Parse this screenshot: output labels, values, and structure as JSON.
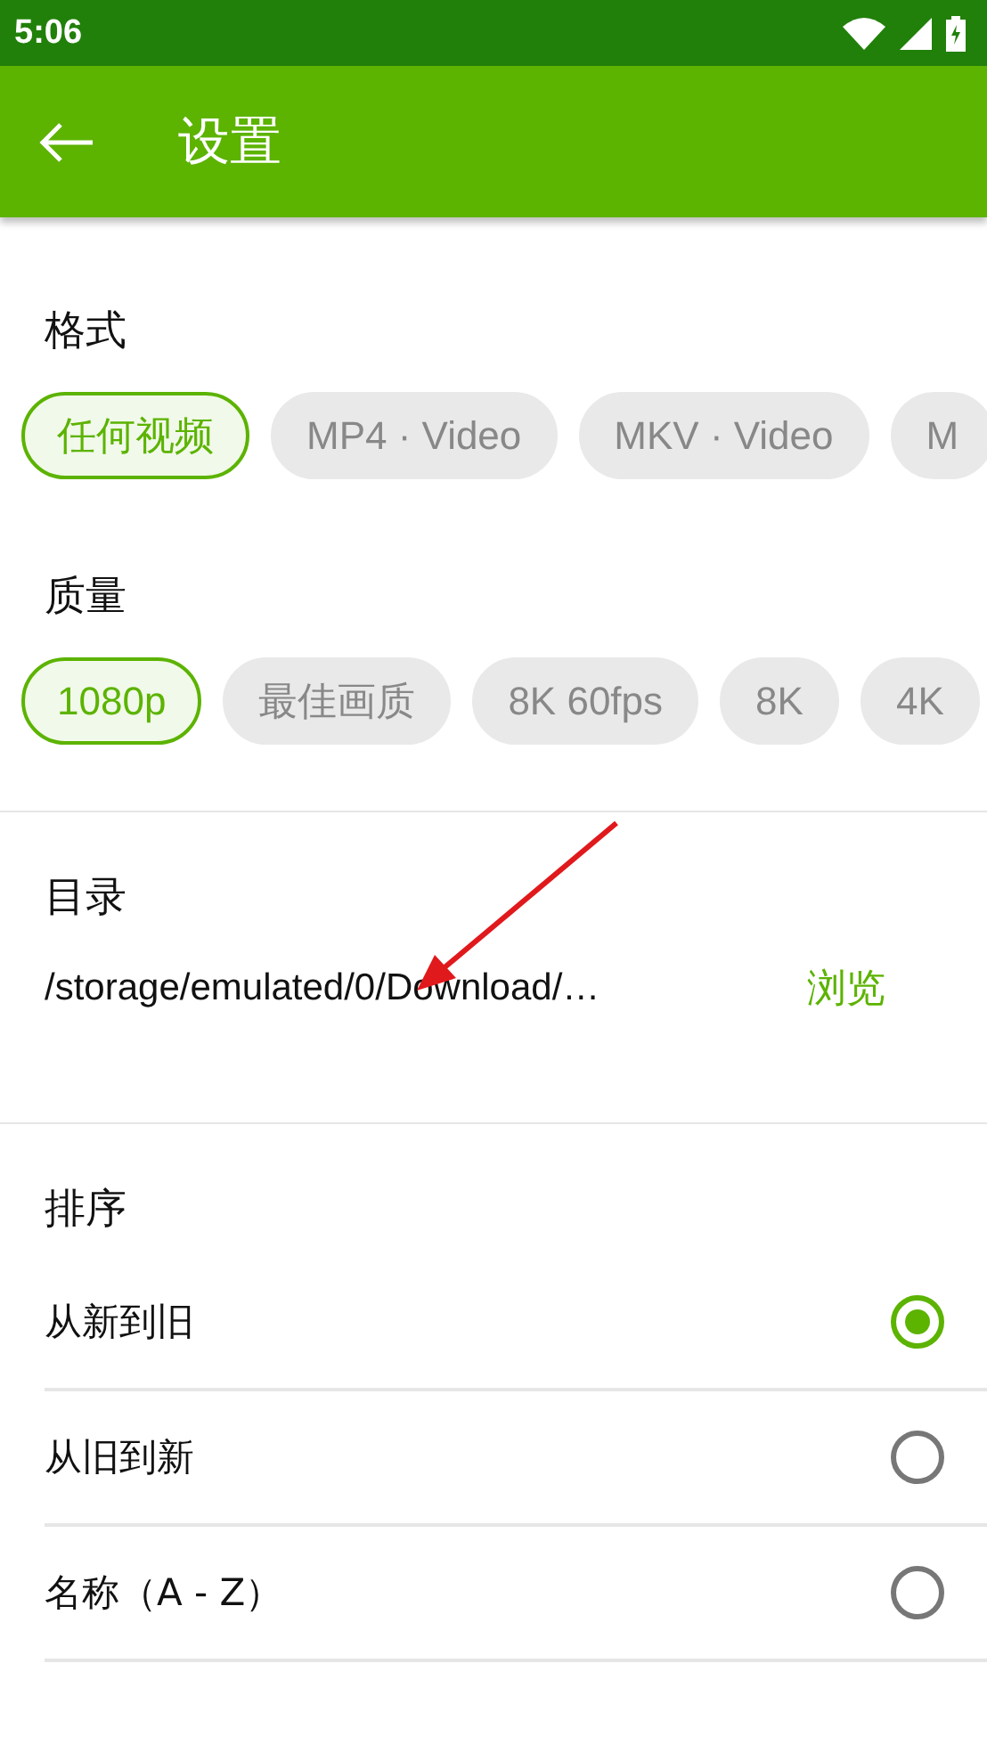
{
  "status_bar": {
    "time": "5:06"
  },
  "toolbar": {
    "title": "设置"
  },
  "format": {
    "title": "格式",
    "chips": [
      {
        "label": "任何视频",
        "selected": true
      },
      {
        "label": "MP4 · Video",
        "selected": false
      },
      {
        "label": "MKV · Video",
        "selected": false
      },
      {
        "label": "M",
        "selected": false
      }
    ]
  },
  "quality": {
    "title": "质量",
    "chips": [
      {
        "label": "1080p",
        "selected": true
      },
      {
        "label": "最佳画质",
        "selected": false
      },
      {
        "label": "8K 60fps",
        "selected": false
      },
      {
        "label": "8K",
        "selected": false
      },
      {
        "label": "4K",
        "selected": false
      }
    ]
  },
  "directory": {
    "title": "目录",
    "path": "/storage/emulated/0/Download/…",
    "browse": "浏览"
  },
  "sort": {
    "title": "排序",
    "options": [
      {
        "label": "从新到旧",
        "selected": true
      },
      {
        "label": "从旧到新",
        "selected": false
      },
      {
        "label": "名称（A - Z）",
        "selected": false
      }
    ]
  }
}
